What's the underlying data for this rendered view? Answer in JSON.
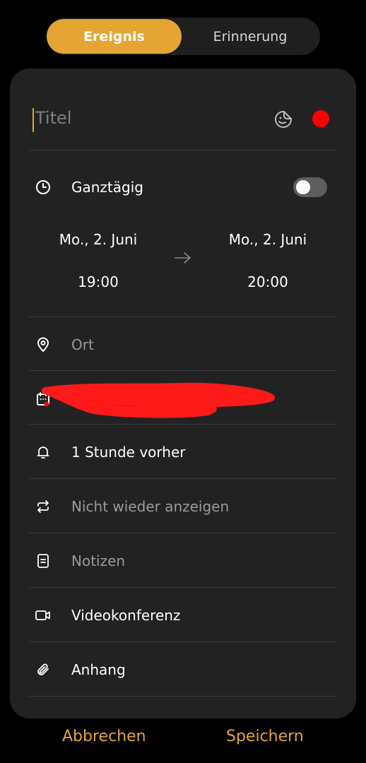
{
  "tabs": {
    "event": "Ereignis",
    "reminder": "Erinnerung"
  },
  "colors": {
    "accent": "#e5a532",
    "event_color": "#ff0000"
  },
  "form": {
    "title_placeholder": "Titel",
    "all_day_label": "Ganztägig",
    "all_day_enabled": false,
    "start": {
      "date": "Mo., 2. Juni",
      "time": "19:00"
    },
    "end": {
      "date": "Mo., 2. Juni",
      "time": "20:00"
    },
    "location_placeholder": "Ort",
    "calendar_account": "",
    "reminder": "1 Stunde vorher",
    "repeat": "Nicht wieder anzeigen",
    "notes_placeholder": "Notizen",
    "video_conference": "Videokonferenz",
    "attachment": "Anhang"
  },
  "actions": {
    "cancel": "Abbrechen",
    "save": "Speichern"
  },
  "icons": [
    "sticker-icon",
    "clock-icon",
    "arrow-right-icon",
    "location-pin-icon",
    "calendar-icon",
    "bell-icon",
    "repeat-icon",
    "notes-icon",
    "video-icon",
    "paperclip-icon"
  ]
}
